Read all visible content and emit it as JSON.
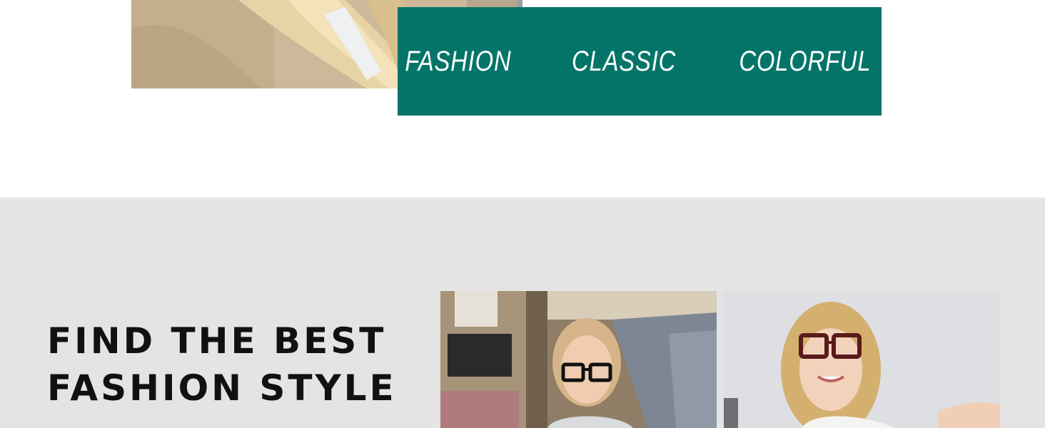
{
  "hero": {
    "image_name": "woman-blonde-hair-photo"
  },
  "tags": {
    "items": [
      "FASHION",
      "CLASSIC",
      "COLORFUL"
    ],
    "background": "#037568",
    "text_color": "#ffffff"
  },
  "feature": {
    "headline_line1": "FIND THE BEST",
    "headline_line2": "FASHION STYLE",
    "background": "#e4e4e4",
    "images": [
      "woman-glasses-sofa-photo",
      "woman-glasses-presenting-photo"
    ]
  }
}
